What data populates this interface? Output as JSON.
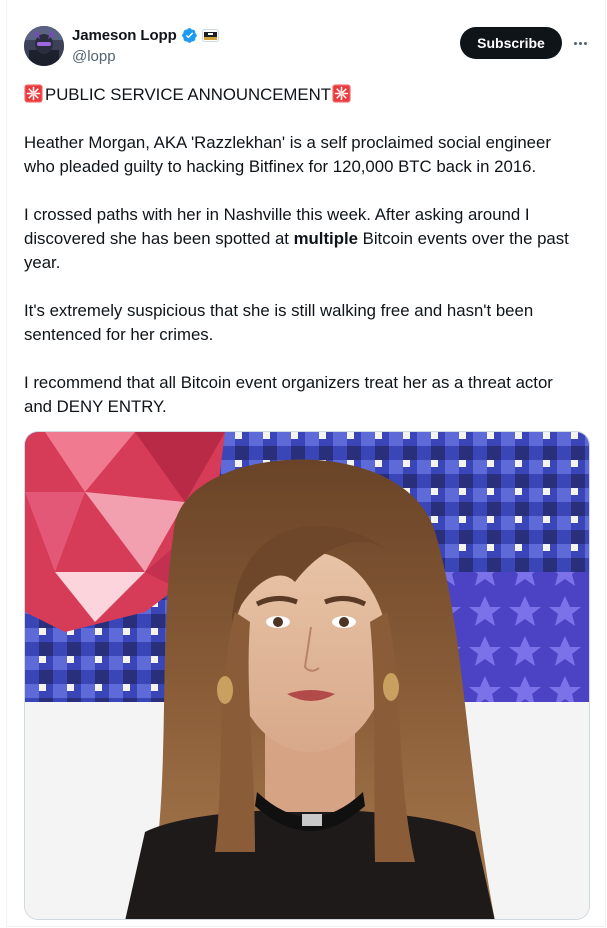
{
  "author": {
    "display_name": "Jameson Lopp",
    "handle": "@lopp"
  },
  "actions": {
    "subscribe_label": "Subscribe"
  },
  "icons": {
    "verified": "verified-badge-icon",
    "affiliate": "affiliate-badge-icon",
    "siren": "rotating-light-emoji",
    "more": "more-options-icon"
  },
  "colors": {
    "verified_blue": "#1d9bf0",
    "text": "#0f1419",
    "secondary_text": "#536471",
    "button_bg": "#0f1419"
  },
  "tweet": {
    "headline": "PUBLIC SERVICE ANNOUNCEMENT",
    "p1": "Heather Morgan, AKA 'Razzlekhan' is a self proclaimed social engineer who pleaded guilty to hacking Bitfinex for 120,000 BTC back in 2016.",
    "p2_before": "I crossed paths with her in Nashville this week. After asking around I discovered she has been spotted at ",
    "p2_bold": "multiple",
    "p2_after": " Bitcoin events over the past year.",
    "p3": "It's extremely suspicious that she is still walking free and hasn't been sentenced for her crimes.",
    "p4": "I recommend that all Bitcoin event organizers treat her as a threat actor and DENY ENTRY."
  }
}
